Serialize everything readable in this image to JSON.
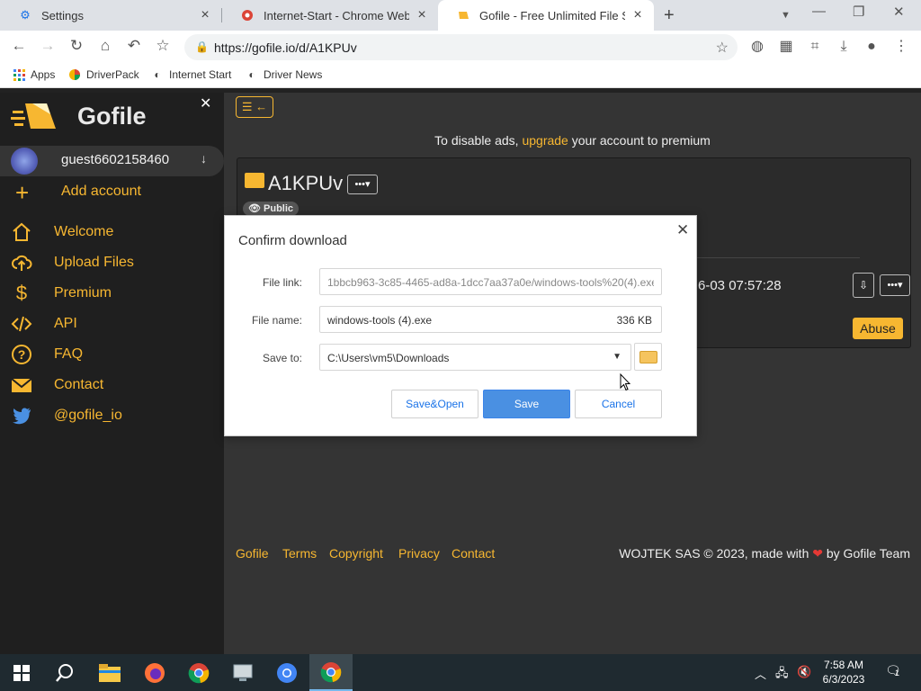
{
  "browser": {
    "tabs": [
      {
        "title": "Settings"
      },
      {
        "title": "Internet-Start - Chrome Web Sto"
      },
      {
        "title": "Gofile - Free Unlimited File Shari"
      }
    ],
    "url": "https://gofile.io/d/A1KPUv",
    "bookmarks": [
      {
        "label": "Apps"
      },
      {
        "label": "DriverPack"
      },
      {
        "label": "Internet Start"
      },
      {
        "label": "Driver News"
      }
    ]
  },
  "sidebar": {
    "brand": "Gofile",
    "account_name": "guest6602158460",
    "add_account": "Add account",
    "items": [
      {
        "label": "Welcome",
        "icon": "home-icon"
      },
      {
        "label": "Upload Files",
        "icon": "upload-cloud-icon"
      },
      {
        "label": "Premium",
        "icon": "dollar-icon"
      },
      {
        "label": "API",
        "icon": "code-icon"
      },
      {
        "label": "FAQ",
        "icon": "question-icon"
      },
      {
        "label": "Contact",
        "icon": "envelope-icon"
      },
      {
        "label": "@gofile_io",
        "icon": "twitter-icon"
      }
    ]
  },
  "main": {
    "ad_note_pre": "To disable ads, ",
    "ad_note_link": "upgrade",
    "ad_note_post": " your account to premium",
    "folder_name": "A1KPUv",
    "public_badge": "Public",
    "file_date": "6-03 07:57:28",
    "abuse_label": "Abuse"
  },
  "footer": {
    "links": [
      {
        "label": "Gofile"
      },
      {
        "label": "Terms"
      },
      {
        "label": "Copyright"
      },
      {
        "label": "Privacy"
      },
      {
        "label": "Contact"
      }
    ],
    "credit_pre": "WOJTEK SAS © 2023, made with ",
    "credit_post": " by Gofile Team"
  },
  "dialog": {
    "title": "Confirm download",
    "file_link_label": "File link:",
    "file_link_value": "1bbcb963-3c85-4465-ad8a-1dcc7aa37a0e/windows-tools%20(4).exe",
    "file_name_label": "File name:",
    "file_name_value": "windows-tools (4).exe",
    "file_size": "336 KB",
    "save_to_label": "Save to:",
    "save_to_value": "C:\\Users\\vm5\\Downloads",
    "save_open_label": "Save&Open",
    "save_label": "Save",
    "cancel_label": "Cancel"
  },
  "taskbar": {
    "time": "7:58 AM",
    "date": "6/3/2023",
    "notification_count": "1"
  },
  "colors": {
    "accent": "#f7b731",
    "primary_button": "#4a90e2",
    "sidebar_bg": "#1f1f1f",
    "page_bg": "#343434"
  }
}
